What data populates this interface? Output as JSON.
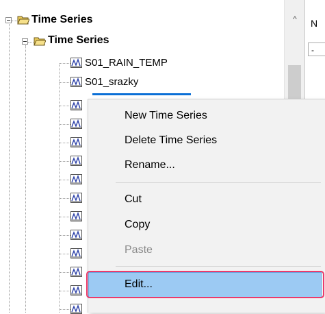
{
  "tree": {
    "root": {
      "label": "Time Series",
      "icon": "folder-open-icon"
    },
    "child": {
      "label": "Time Series",
      "icon": "folder-open-icon"
    },
    "items": [
      {
        "label": "S01_RAIN_TEMP",
        "icon": "time-series-icon"
      },
      {
        "label": "S01_srazky",
        "icon": "time-series-icon"
      }
    ]
  },
  "scrollbar": {
    "up_arrow": "^"
  },
  "right_panel": {
    "letter": "N",
    "dash": "-"
  },
  "context_menu": {
    "items": [
      {
        "label": "New Time Series",
        "enabled": true
      },
      {
        "label": "Delete Time Series",
        "enabled": true
      },
      {
        "label": "Rename...",
        "enabled": true
      },
      {
        "label": "Cut",
        "enabled": true
      },
      {
        "label": "Copy",
        "enabled": true
      },
      {
        "label": "Paste",
        "enabled": false
      },
      {
        "label": "Edit...",
        "enabled": true,
        "highlighted": true
      }
    ]
  },
  "colors": {
    "highlight": "#9ccaf3",
    "callout": "#ec3a6b",
    "selection_underline": "#0a6fd6"
  }
}
